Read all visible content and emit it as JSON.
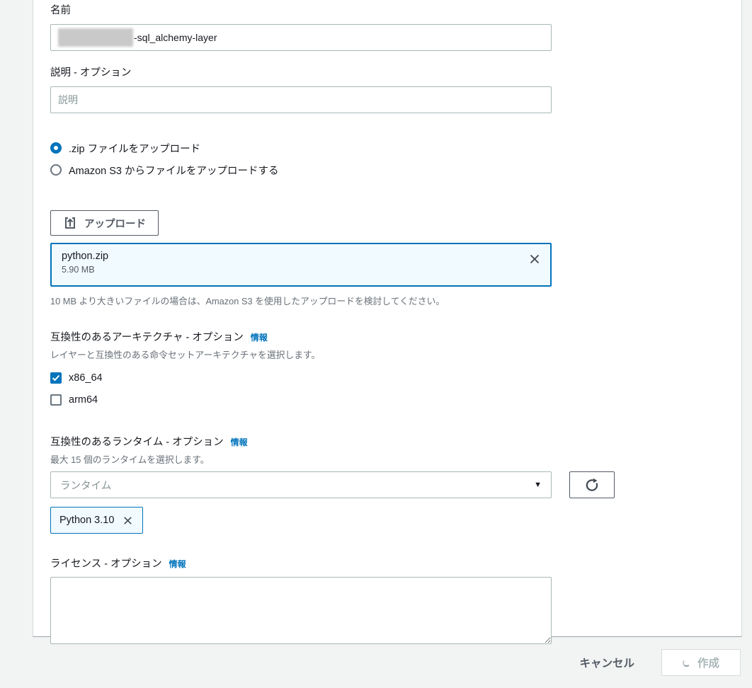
{
  "colors": {
    "accent_blue": "#0073bb",
    "selected_bg": "#f1faff",
    "page_bg": "#f2f3f3",
    "input_border": "#aab7b8",
    "text_dark": "#16191f",
    "text_secondary": "#687078",
    "button_gray": "#545b64",
    "disabled_text": "#aab7b8"
  },
  "form": {
    "name_field": {
      "label": "名前",
      "value": "-sql_alchemy-layer"
    },
    "description_field": {
      "label": "説明 - オプション",
      "placeholder": "説明"
    },
    "upload_source": {
      "options": [
        {
          "label": ".zip ファイルをアップロード",
          "selected": true
        },
        {
          "label": "Amazon S3 からファイルをアップロードする",
          "selected": false
        }
      ]
    },
    "upload_button": {
      "label": "アップロード"
    },
    "selected_file": {
      "name": "python.zip",
      "size": "5.90 MB"
    },
    "file_hint": "10 MB より大きいファイルの場合は、Amazon S3 を使用したアップロードを検討してください。",
    "architectures": {
      "label": "互換性のあるアーキテクチャ - オプション",
      "info_link": "情報",
      "description": "レイヤーと互換性のある命令セットアーキテクチャを選択します。",
      "options": [
        {
          "label": "x86_64",
          "checked": true
        },
        {
          "label": "arm64",
          "checked": false
        }
      ]
    },
    "runtimes": {
      "label": "互換性のあるランタイム - オプション",
      "info_link": "情報",
      "description": "最大 15 個のランタイムを選択します。",
      "select_placeholder": "ランタイム",
      "selected_tokens": [
        {
          "label": "Python 3.10"
        }
      ]
    },
    "license": {
      "label": "ライセンス - オプション",
      "info_link": "情報"
    }
  },
  "footer": {
    "cancel_label": "キャンセル",
    "create_label": "作成"
  }
}
